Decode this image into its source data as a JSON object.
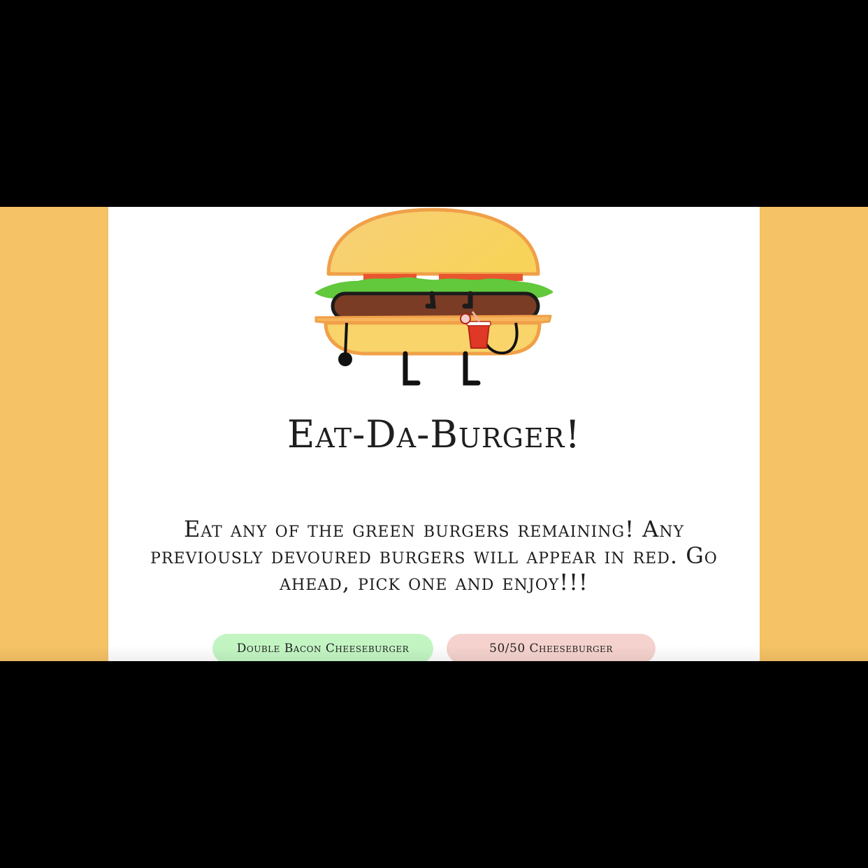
{
  "page": {
    "title": "Eat-Da-Burger!",
    "intro": "Eat any of the green burgers remaining! Any previously devoured burgers will appear in red. Go ahead, pick one and enjoy!!!"
  },
  "burgers": [
    {
      "name": "Double Bacon Cheeseburger",
      "status": "available",
      "color": "#c3f5c3"
    },
    {
      "name": "50/50 Cheeseburger",
      "status": "devoured",
      "color": "#f5d2cd"
    }
  ],
  "mascot": {
    "icon": "burger-mascot-icon"
  },
  "colors": {
    "page_background": "#f5c265",
    "card_background": "#ffffff",
    "available": "#c3f5c3",
    "devoured": "#f5d2cd"
  }
}
